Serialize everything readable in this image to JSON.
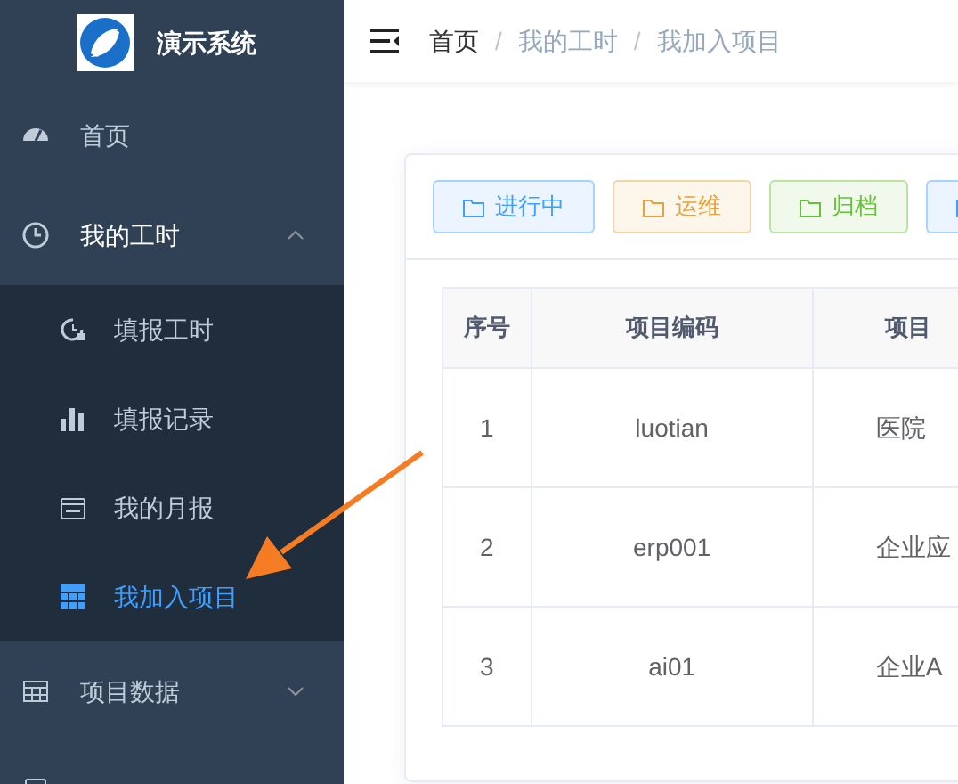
{
  "sidebar": {
    "logo_title": "演示系统",
    "items": [
      {
        "label": "首页",
        "kind": "item",
        "selected": false
      },
      {
        "label": "我的工时",
        "kind": "group",
        "expanded": true,
        "selected": false,
        "children": [
          {
            "label": "填报工时",
            "selected": false
          },
          {
            "label": "填报记录",
            "selected": false
          },
          {
            "label": "我的月报",
            "selected": false
          },
          {
            "label": "我加入项目",
            "selected": true
          }
        ]
      },
      {
        "label": "项目数据",
        "kind": "group",
        "expanded": false,
        "selected": false
      },
      {
        "kind": "group",
        "expanded": false,
        "selected": false
      }
    ]
  },
  "breadcrumb": [
    "首页",
    "我的工时",
    "我加入项目"
  ],
  "breadcrumb_separator": "/",
  "filters": [
    {
      "label": "进行中",
      "color": "#409eff"
    },
    {
      "label": "运维",
      "color": "#e6a23c"
    },
    {
      "label": "归档",
      "color": "#67c23a"
    },
    {
      "color": "#409eff"
    }
  ],
  "table": {
    "columns": [
      "序号",
      "项目编码",
      "项目"
    ],
    "rows": [
      [
        "1",
        "luotian",
        "医院"
      ],
      [
        "2",
        "erp001",
        "企业应"
      ],
      [
        "3",
        "ai01",
        "企业A"
      ]
    ]
  }
}
